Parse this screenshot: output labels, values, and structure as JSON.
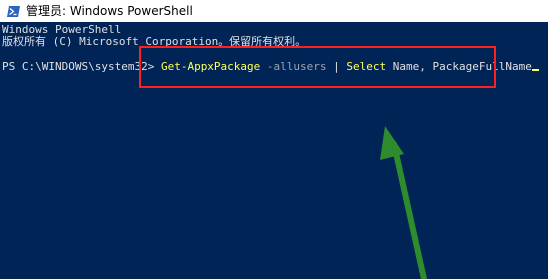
{
  "window": {
    "title": "管理员: Windows PowerShell",
    "icon": "powershell-icon"
  },
  "console": {
    "header_line_1": "Windows PowerShell",
    "header_line_2": "版权所有 (C) Microsoft Corporation。保留所有权利。",
    "prompt": "PS C:\\WINDOWS\\system32> ",
    "command": {
      "cmdlet": "Get-AppxPackage",
      "space1": " ",
      "parameter": "-allusers",
      "pipe": " | ",
      "select": "Select",
      "args": " Name, PackageFullName"
    }
  },
  "colors": {
    "console_bg": "#012456",
    "highlight_box": "#ff1f1f",
    "arrow": "#2e8b2e",
    "command_text": "#ffff55"
  },
  "annotation": {
    "arrow_icon": "green-arrow-icon"
  }
}
